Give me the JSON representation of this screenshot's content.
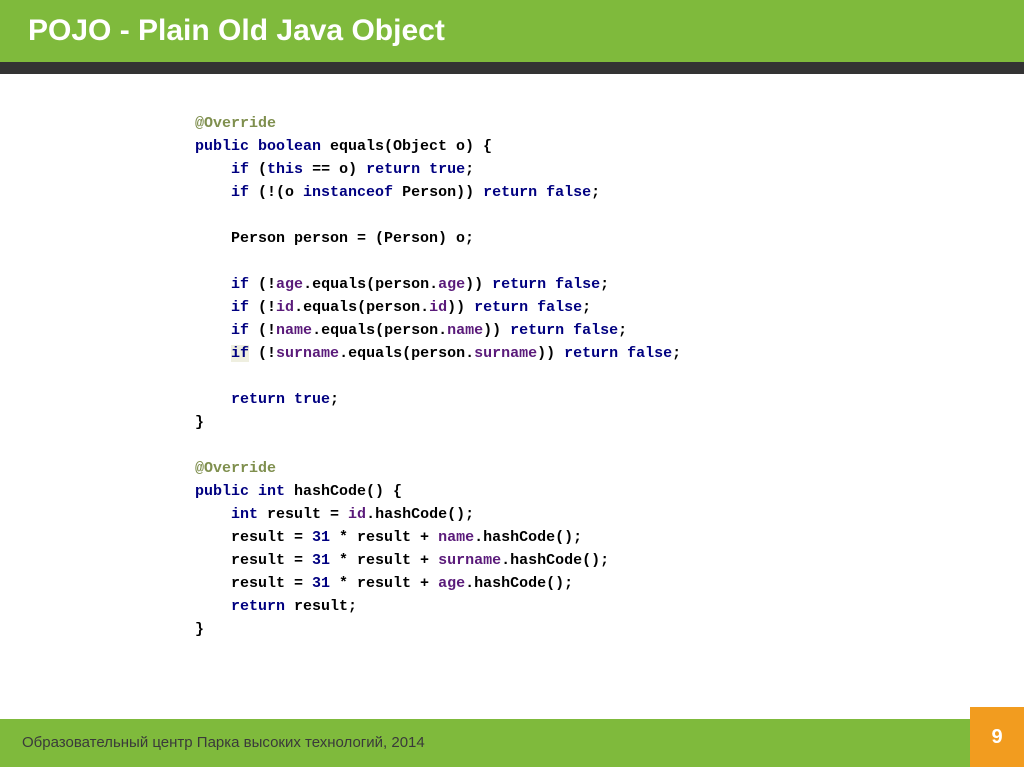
{
  "header": {
    "title": "POJO - Plain Old Java Object"
  },
  "code": {
    "line1a": "@Override",
    "line2a": "public",
    "line2b": " boolean",
    "line2c": " equals(Object o) {",
    "line3a": "if",
    "line3b": " (",
    "line3c": "this",
    "line3d": " == o) ",
    "line3e": "return true",
    "line3f": ";",
    "line4a": "if",
    "line4b": " (!(o ",
    "line4c": "instanceof",
    "line4d": " Person)) ",
    "line4e": "return false",
    "line4f": ";",
    "line5a": "Person person = (Person) o;",
    "line6a": "if",
    "line6b": " (!",
    "line6c": "age",
    "line6d": ".equals(person.",
    "line6e": "age",
    "line6f": ")) ",
    "line6g": "return false",
    "line6h": ";",
    "line7a": "if",
    "line7b": " (!",
    "line7c": "id",
    "line7d": ".equals(person.",
    "line7e": "id",
    "line7f": ")) ",
    "line7g": "return false",
    "line7h": ";",
    "line8a": "if",
    "line8b": " (!",
    "line8c": "name",
    "line8d": ".equals(person.",
    "line8e": "name",
    "line8f": ")) ",
    "line8g": "return false",
    "line8h": ";",
    "line9a": "if",
    "line9b": " (!",
    "line9c": "surname",
    "line9d": ".equals(person.",
    "line9e": "surname",
    "line9f": ")) ",
    "line9g": "return false",
    "line9h": ";",
    "line10a": "return true",
    "line10b": ";",
    "line11a": "}",
    "line12a": "@Override",
    "line13a": "public",
    "line13b": " int",
    "line13c": " hashCode() {",
    "line14a": "int",
    "line14b": " result = ",
    "line14c": "id",
    "line14d": ".hashCode();",
    "line15a": "result = ",
    "line15b": "31",
    "line15c": " * result + ",
    "line15d": "name",
    "line15e": ".hashCode();",
    "line16a": "result = ",
    "line16b": "31",
    "line16c": " * result + ",
    "line16d": "surname",
    "line16e": ".hashCode();",
    "line17a": "result = ",
    "line17b": "31",
    "line17c": " * result + ",
    "line17d": "age",
    "line17e": ".hashCode();",
    "line18a": "return",
    "line18b": " result;",
    "line19a": "}"
  },
  "footer": {
    "text": "Образовательный центр Парка высоких технологий, 2014",
    "page": "9"
  }
}
